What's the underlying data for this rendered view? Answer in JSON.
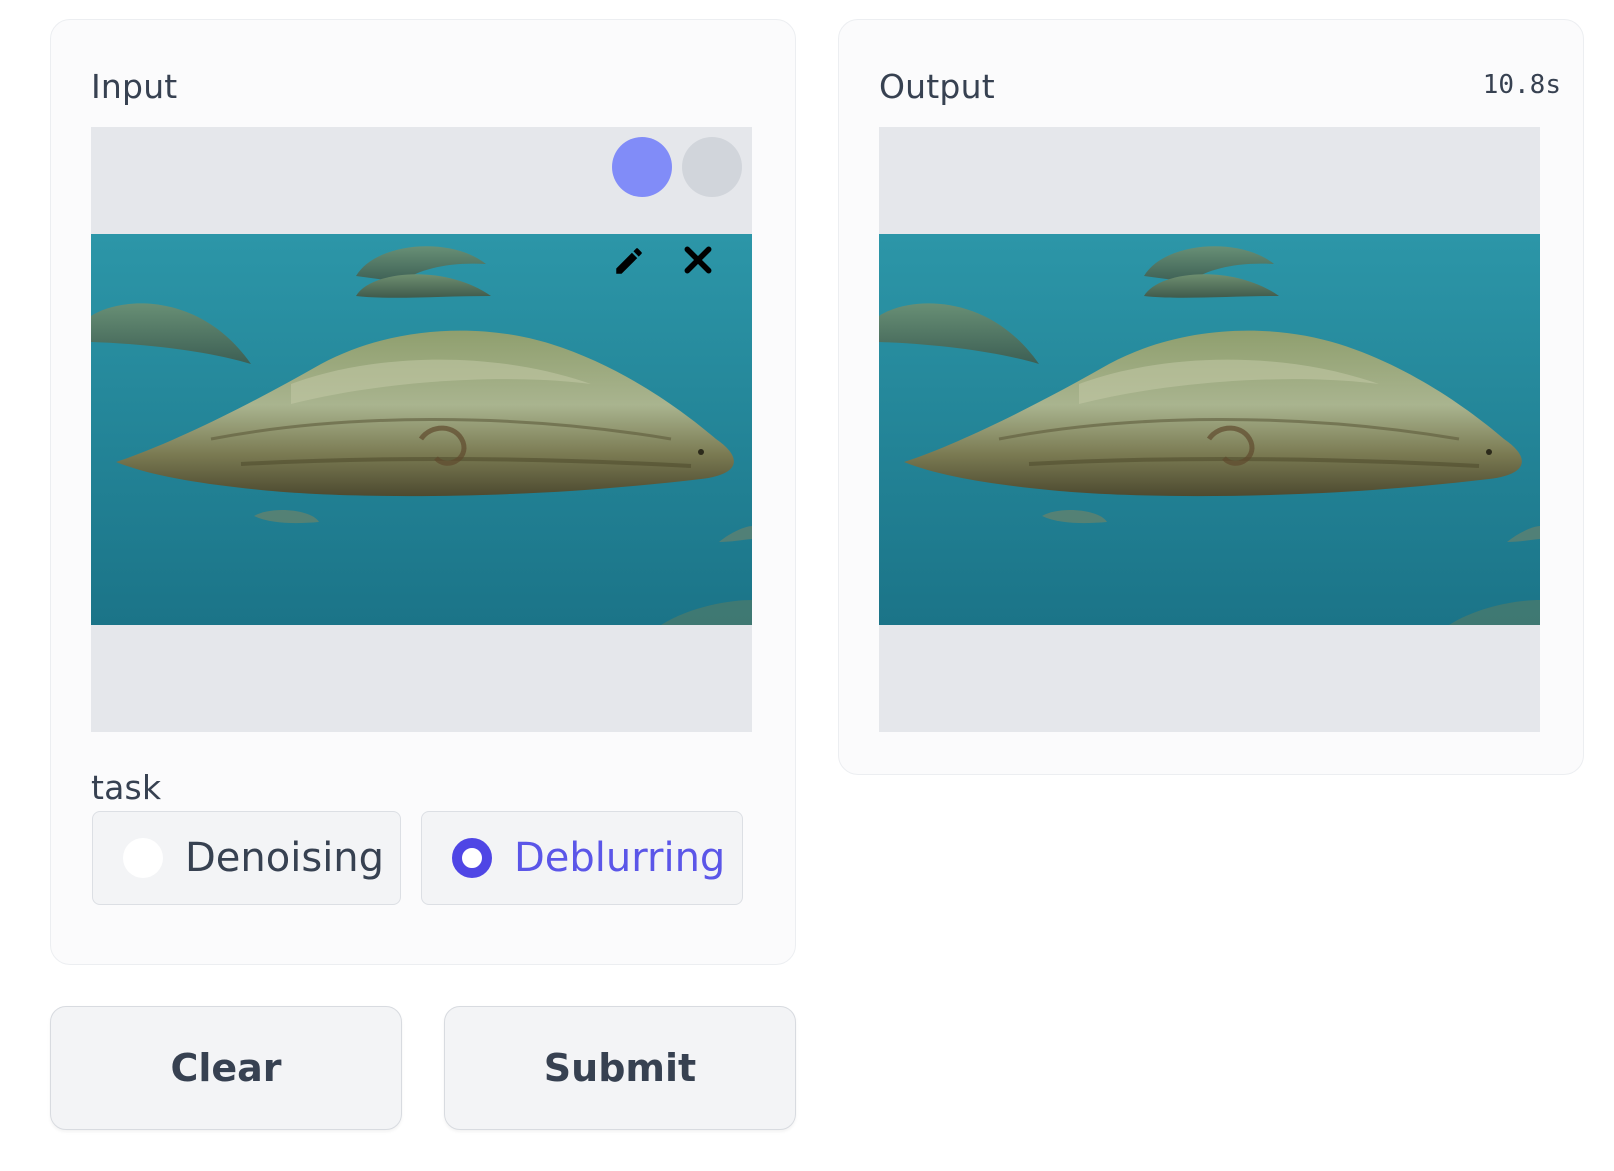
{
  "input": {
    "label": "Input"
  },
  "output": {
    "label": "Output",
    "timer": "10.8s"
  },
  "task": {
    "label": "task",
    "options": [
      {
        "label": "Denoising",
        "selected": false
      },
      {
        "label": "Deblurring",
        "selected": true
      }
    ]
  },
  "buttons": {
    "clear": "Clear",
    "submit": "Submit"
  },
  "icons": {
    "edit": "pencil-icon",
    "remove": "close-icon"
  },
  "colors": {
    "accent": "#4f46e5",
    "edit_button": "#818cf8",
    "water": "#1f8497"
  }
}
